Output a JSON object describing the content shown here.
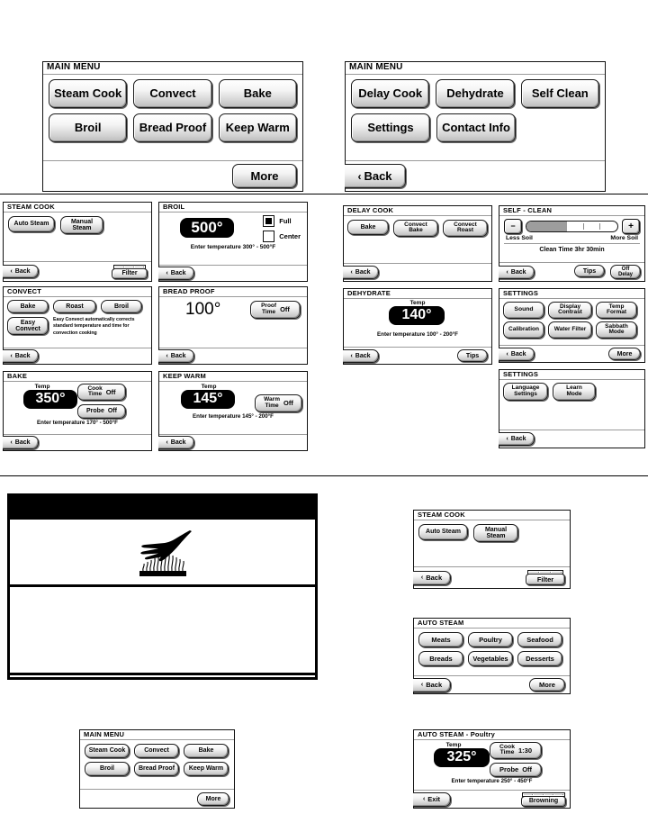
{
  "meta": {
    "document_kind": "oven-control-panel-menu-map",
    "degree": "°",
    "chev": "‹"
  },
  "main_menu_1": {
    "title": "MAIN MENU",
    "buttons": [
      "Steam Cook",
      "Convect",
      "Bake",
      "Broil",
      "Bread Proof",
      "Keep Warm"
    ],
    "more": "More"
  },
  "main_menu_2": {
    "title": "MAIN MENU",
    "buttons": [
      "Delay Cook",
      "Dehydrate",
      "Self Clean",
      "Settings",
      "Contact Info"
    ],
    "back": "Back"
  },
  "steam_cook": {
    "title": "STEAM COOK",
    "auto": "Auto Steam",
    "manual_l1": "Manual",
    "manual_l2": "Steam",
    "back": "Back",
    "filter": "Filter",
    "filter_icon": "filter-level-bar"
  },
  "broil": {
    "title": "BROIL",
    "temp": "500°",
    "full": "Full",
    "center": "Center",
    "full_checked": true,
    "center_checked": false,
    "hint": "Enter temperature 300° - 500°F",
    "back": "Back"
  },
  "convect": {
    "title": "CONVECT",
    "buttons": [
      "Bake",
      "Roast",
      "Broil"
    ],
    "easy_l1": "Easy",
    "easy_l2": "Convect",
    "info": "Easy Convect automatically corrects standard temperature and time for convection cooking",
    "back": "Back"
  },
  "bread_proof": {
    "title": "BREAD PROOF",
    "temp": "100°",
    "proof_l1": "Proof",
    "proof_l2": "Time",
    "proof_value": "Off",
    "back": "Back"
  },
  "bake": {
    "title": "BAKE",
    "temp_label": "Temp",
    "temp": "350°",
    "cook_l1": "Cook",
    "cook_l2": "Time",
    "cook_value": "Off",
    "probe_label": "Probe",
    "probe_value": "Off",
    "hint": "Enter temperature 170° - 500°F",
    "back": "Back"
  },
  "keep_warm": {
    "title": "KEEP WARM",
    "temp_label": "Temp",
    "temp": "145°",
    "warm_l1": "Warm",
    "warm_l2": "Time",
    "warm_value": "Off",
    "hint": "Enter temperature 145° - 200°F",
    "back": "Back"
  },
  "delay_cook": {
    "title": "DELAY COOK",
    "bake": "Bake",
    "convect_bake_l1": "Convect",
    "convect_bake_l2": "Bake",
    "convect_roast_l1": "Convect",
    "convect_roast_l2": "Roast",
    "back": "Back"
  },
  "self_clean": {
    "title": "SELF - CLEAN",
    "minus": "−",
    "plus": "+",
    "less": "Less Soil",
    "more": "More Soil",
    "clean_time": "Clean Time  3hr 30min",
    "slider_percent": 45,
    "back": "Back",
    "tips": "Tips",
    "delay_l1": "Off",
    "delay_l2": "Delay"
  },
  "dehydrate": {
    "title": "DEHYDRATE",
    "temp_label": "Temp",
    "temp": "140°",
    "hint": "Enter temperature 100° - 200°F",
    "back": "Back",
    "tips": "Tips"
  },
  "settings_1": {
    "title": "SETTINGS",
    "buttons": [
      {
        "l1": "Sound",
        "l2": ""
      },
      {
        "l1": "Display",
        "l2": "Contrast"
      },
      {
        "l1": "Temp",
        "l2": "Format"
      },
      {
        "l1": "Calibration",
        "l2": ""
      },
      {
        "l1": "Water Filter",
        "l2": ""
      },
      {
        "l1": "Sabbath",
        "l2": "Mode"
      }
    ],
    "back": "Back",
    "more": "More"
  },
  "settings_2": {
    "title": "SETTINGS",
    "language_l1": "Language",
    "language_l2": "Settings",
    "learn_l1": "Learn",
    "learn_l2": "Mode",
    "back": "Back"
  },
  "warning": {
    "icon_name": "hot-surface-hand-burn-hazard",
    "top_bar": "",
    "middle_text": "",
    "bottom_text": ""
  },
  "main_menu_3": {
    "title": "MAIN MENU",
    "buttons": [
      "Steam Cook",
      "Convect",
      "Bake",
      "Broil",
      "Bread Proof",
      "Keep Warm"
    ],
    "more": "More"
  },
  "steam_cook_2": {
    "title": "STEAM COOK",
    "auto": "Auto Steam",
    "manual_l1": "Manual",
    "manual_l2": "Steam",
    "back": "Back",
    "filter": "Filter"
  },
  "auto_steam": {
    "title": "AUTO STEAM",
    "buttons": [
      "Meats",
      "Poultry",
      "Seafood",
      "Breads",
      "Vegetables",
      "Desserts"
    ],
    "back": "Back",
    "more": "More"
  },
  "auto_steam_poultry": {
    "title": "AUTO STEAM - Poultry",
    "temp_label": "Temp",
    "temp": "325°",
    "cook_l1": "Cook",
    "cook_l2": "Time",
    "cook_value": "1:30",
    "probe_label": "Probe",
    "probe_value": "Off",
    "hint": "Enter temperature 250° - 450°F",
    "exit": "Exit",
    "browning": "Browning"
  }
}
